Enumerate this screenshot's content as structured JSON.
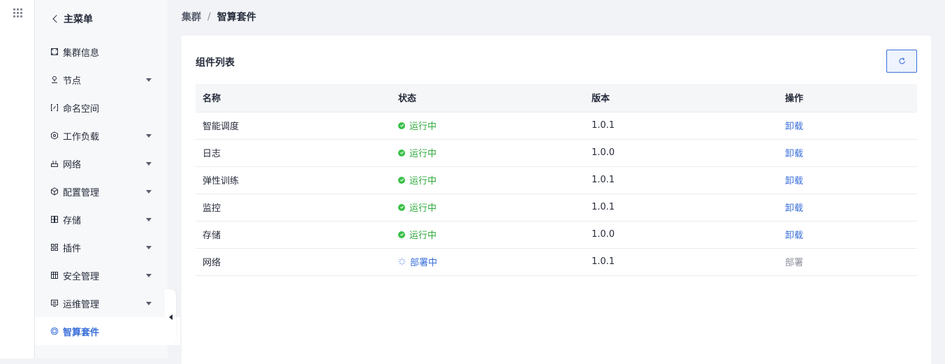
{
  "sidebar": {
    "back_label": "主菜单",
    "items": [
      {
        "label": "集群信息",
        "icon": "cluster-icon",
        "has_caret": false
      },
      {
        "label": "节点",
        "icon": "node-icon",
        "has_caret": true
      },
      {
        "label": "命名空间",
        "icon": "namespace-icon",
        "has_caret": false
      },
      {
        "label": "工作负载",
        "icon": "workload-icon",
        "has_caret": true
      },
      {
        "label": "网络",
        "icon": "network-icon",
        "has_caret": true
      },
      {
        "label": "配置管理",
        "icon": "config-icon",
        "has_caret": true
      },
      {
        "label": "存储",
        "icon": "storage-icon",
        "has_caret": true
      },
      {
        "label": "插件",
        "icon": "plugin-icon",
        "has_caret": true
      },
      {
        "label": "安全管理",
        "icon": "security-icon",
        "has_caret": true
      },
      {
        "label": "运维管理",
        "icon": "ops-icon",
        "has_caret": true
      },
      {
        "label": "智算套件",
        "icon": "ai-suite-icon",
        "has_caret": false,
        "active": true
      }
    ]
  },
  "breadcrumb": {
    "parent": "集群",
    "separator": "/",
    "current": "智算套件"
  },
  "card": {
    "title": "组件列表",
    "columns": {
      "name": "名称",
      "status": "状态",
      "version": "版本",
      "actions": "操作"
    },
    "rows": [
      {
        "name": "智能调度",
        "status": "运行中",
        "state": "running",
        "version": "1.0.1",
        "action": "卸载"
      },
      {
        "name": "日志",
        "status": "运行中",
        "state": "running",
        "version": "1.0.0",
        "action": "卸载"
      },
      {
        "name": "弹性训练",
        "status": "运行中",
        "state": "running",
        "version": "1.0.1",
        "action": "卸载"
      },
      {
        "name": "监控",
        "status": "运行中",
        "state": "running",
        "version": "1.0.1",
        "action": "卸载"
      },
      {
        "name": "存储",
        "status": "运行中",
        "state": "running",
        "version": "1.0.0",
        "action": "卸载"
      },
      {
        "name": "网络",
        "status": "部署中",
        "state": "deploying",
        "version": "1.0.1",
        "action": "部署"
      }
    ]
  },
  "colors": {
    "accent": "#3a6fd9",
    "running": "#2fa93c",
    "muted": "#8a8e99"
  }
}
